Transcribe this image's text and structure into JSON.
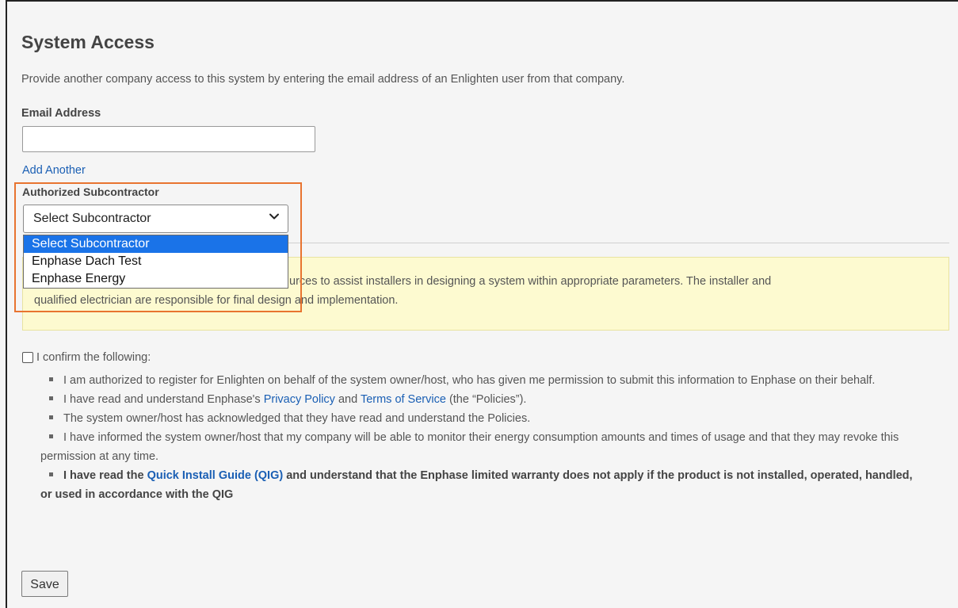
{
  "page": {
    "title": "System Access",
    "intro": "Provide another company access to this system by entering the email address of an Enlighten user from that company."
  },
  "email": {
    "label": "Email Address",
    "value": "",
    "add_another": "Add Another"
  },
  "subcontractor": {
    "label": "Authorized Subcontractor",
    "selected": "Select Subcontractor",
    "options": [
      "Select Subcontractor",
      "Enphase Dach Test",
      "Enphase Energy"
    ]
  },
  "notice": {
    "text_visible": "urces to assist installers in designing a system within appropriate parameters. The installer and",
    "line2_visible": "nal design and implementation.",
    "line2_hidden_prefix": "qualified electrician are responsible for fi"
  },
  "confirm": {
    "label": "I confirm the following:",
    "items": [
      {
        "text": "I am authorized to register for Enlighten on behalf of the system owner/host, who has given me permission to submit this information to Enphase on their behalf."
      },
      {
        "pre": "I have read and understand Enphase's ",
        "link1": "Privacy Policy",
        "mid": " and ",
        "link2": "Terms of Service",
        "post": " (the “Policies”)."
      },
      {
        "text": "The system owner/host has acknowledged that they have read and understand the Policies."
      },
      {
        "text": "I have informed the system owner/host that my company will be able to monitor their energy consumption amounts and times of usage and that they may revoke this permission at any time."
      },
      {
        "pre": "I have read the ",
        "link": "Quick Install Guide (QIG)",
        "post": " and understand that the Enphase limited warranty does not apply if the product is not installed, operated, handled, or used in accordance with the QIG"
      }
    ]
  },
  "actions": {
    "save": "Save"
  },
  "colors": {
    "link": "#1a5fb4",
    "highlight": "#e87430",
    "notice_bg": "#fdfad0",
    "option_selected": "#1a73e8"
  }
}
